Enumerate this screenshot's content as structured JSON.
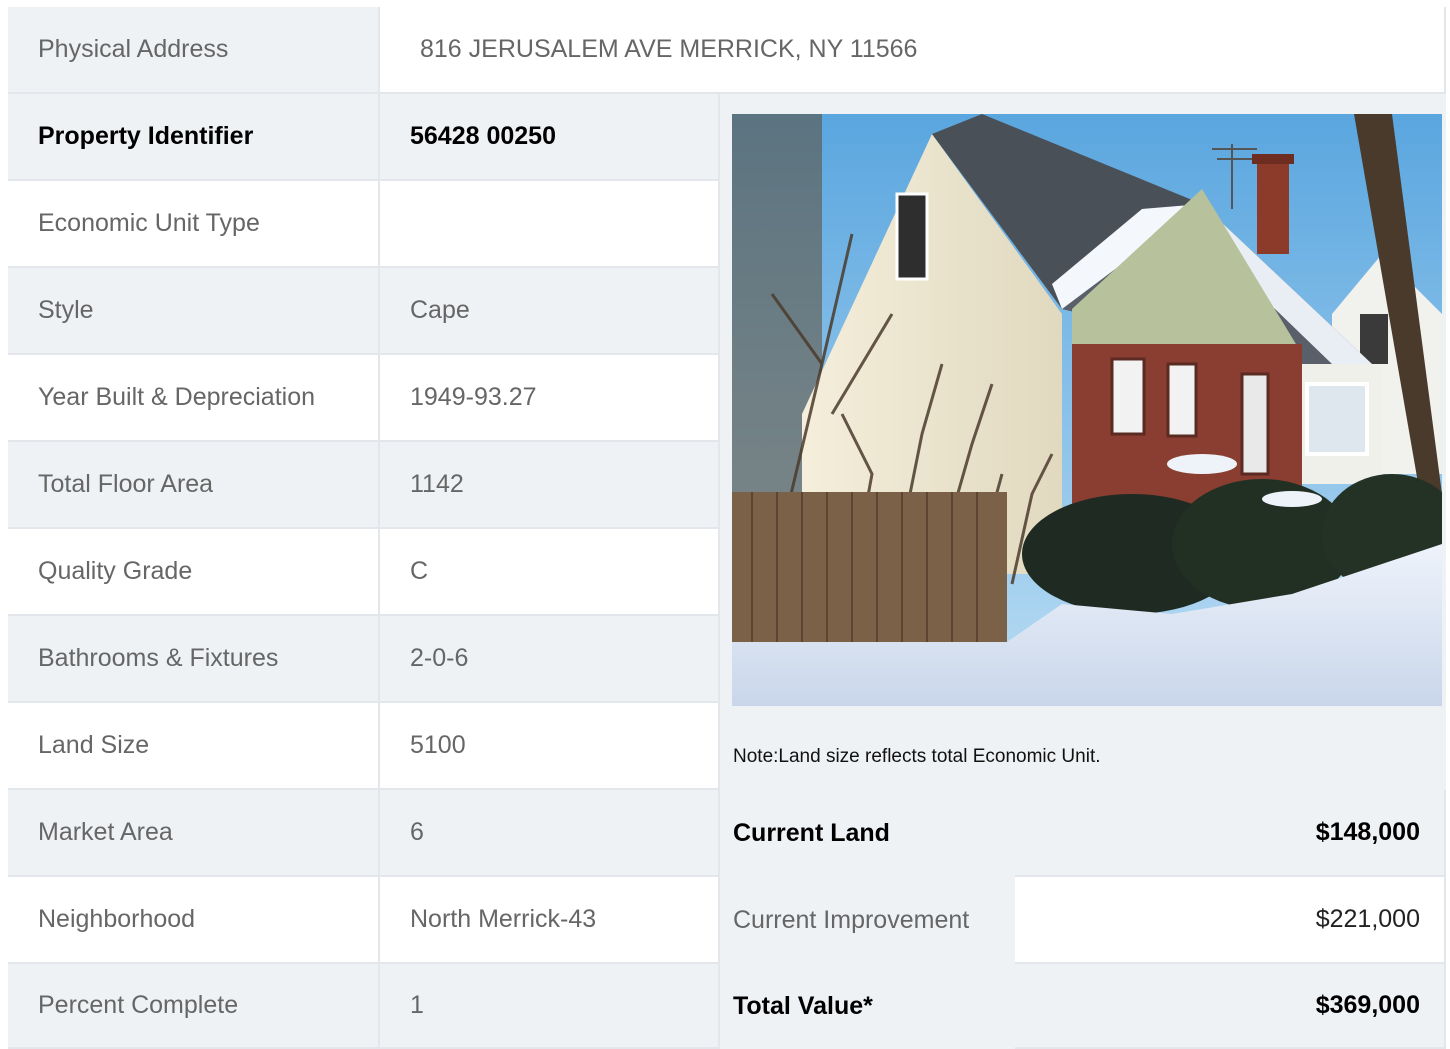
{
  "address": {
    "label": "Physical Address",
    "value": "816  JERUSALEM AVE  MERRICK, NY  11566"
  },
  "property_rows": [
    {
      "label": "Property Identifier",
      "value": "56428  00250",
      "bold": true
    },
    {
      "label": "Economic Unit Type",
      "value": ""
    },
    {
      "label": "Style",
      "value": "Cape"
    },
    {
      "label": "Year Built & Depreciation",
      "value": "1949-93.27"
    },
    {
      "label": "Total Floor Area",
      "value": "1142"
    },
    {
      "label": "Quality Grade",
      "value": "C"
    },
    {
      "label": "Bathrooms & Fixtures",
      "value": "2-0-6"
    },
    {
      "label": "Land Size",
      "value": "5100"
    },
    {
      "label": "Market Area",
      "value": "6"
    },
    {
      "label": "Neighborhood",
      "value": "North Merrick-43"
    },
    {
      "label": "Percent Complete",
      "value": "1"
    }
  ],
  "note": "Note:Land size reflects total Economic Unit.",
  "valuation": [
    {
      "label": "Current Land",
      "value": "$148,000",
      "bold": true
    },
    {
      "label": "Current Improvement",
      "value": "$221,000",
      "bold": false
    },
    {
      "label": "Total Value*",
      "value": "$369,000",
      "bold": true
    }
  ],
  "colors": {
    "shade": "#eff2f5",
    "border": "#e3e6ea",
    "text": "#666666"
  }
}
